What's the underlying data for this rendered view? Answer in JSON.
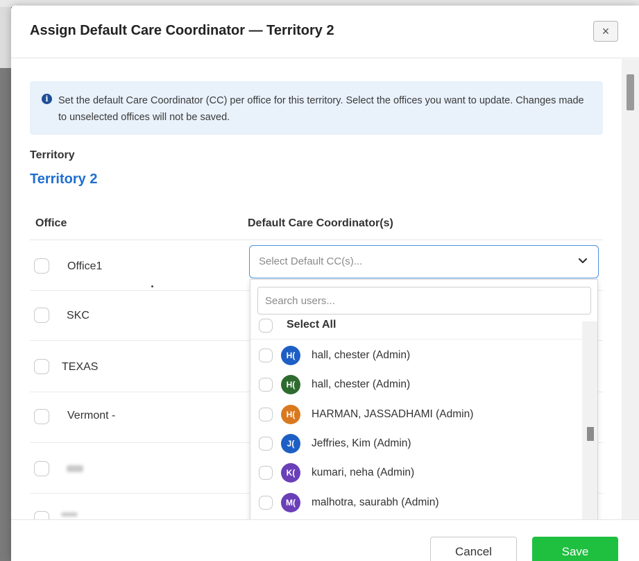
{
  "modal": {
    "title": "Assign Default Care Coordinator — Territory 2",
    "close_label": "×"
  },
  "info": {
    "icon": "info-icon",
    "glyph": "i",
    "text": "Set the default Care Coordinator (CC) per office for this territory. Select the offices you want to update. Changes made to unselected offices will not be saved."
  },
  "territory": {
    "label": "Territory",
    "value": "Territory 2"
  },
  "table": {
    "col_office": "Office",
    "col_cc": "Default Care Coordinator(s)",
    "offices": [
      {
        "name": "Office1"
      },
      {
        "name": "SKC"
      },
      {
        "name": "TEXAS"
      },
      {
        "name": "Vermont -"
      }
    ]
  },
  "cc_select": {
    "placeholder": "Select Default CC(s)...",
    "chevron_icon": "chevron-down-icon"
  },
  "dropdown": {
    "search_placeholder": "Search users...",
    "select_all_label": "Select All",
    "users": [
      {
        "initials": "H(",
        "name": "hall, chester (Admin)",
        "color": "#1d5fc4"
      },
      {
        "initials": "H(",
        "name": "hall, chester (Admin)",
        "color": "#2e6b2f"
      },
      {
        "initials": "H(",
        "name": "HARMAN, JASSADHAMI (Admin)",
        "color": "#d9781f"
      },
      {
        "initials": "J(",
        "name": "Jeffries, Kim (Admin)",
        "color": "#1d5fc4"
      },
      {
        "initials": "K(",
        "name": "kumari, neha (Admin)",
        "color": "#6a3fb8"
      },
      {
        "initials": "M(",
        "name": "malhotra, saurabh (Admin)",
        "color": "#6a3fb8"
      }
    ]
  },
  "footer": {
    "cancel_label": "Cancel",
    "save_label": "Save"
  },
  "colors": {
    "accent": "#1f6fd0",
    "save": "#1fbf3f",
    "info_bg": "#e9f1fb"
  }
}
